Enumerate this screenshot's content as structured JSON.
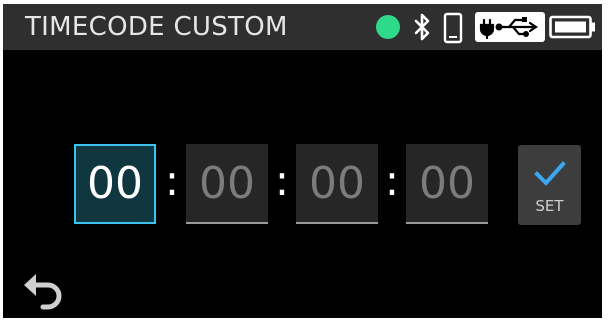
{
  "header": {
    "title": "TIMECODE CUSTOM"
  },
  "status": {
    "indicator_color": "#2ed98a",
    "icons": [
      "status-dot",
      "bluetooth-icon",
      "phone-icon",
      "power-usb-icon",
      "battery-icon"
    ]
  },
  "timecode": {
    "fields": [
      {
        "value": "00",
        "active": true
      },
      {
        "value": "00",
        "active": false
      },
      {
        "value": "00",
        "active": false
      },
      {
        "value": "00",
        "active": false
      }
    ],
    "separator": ":"
  },
  "set_button": {
    "label": "SET",
    "icon": "checkmark-icon"
  },
  "back_button": {
    "icon": "back-arrow-icon"
  },
  "colors": {
    "accent": "#3ac4ee",
    "header_bg": "#2f2f2f",
    "screen_bg": "#000000"
  }
}
